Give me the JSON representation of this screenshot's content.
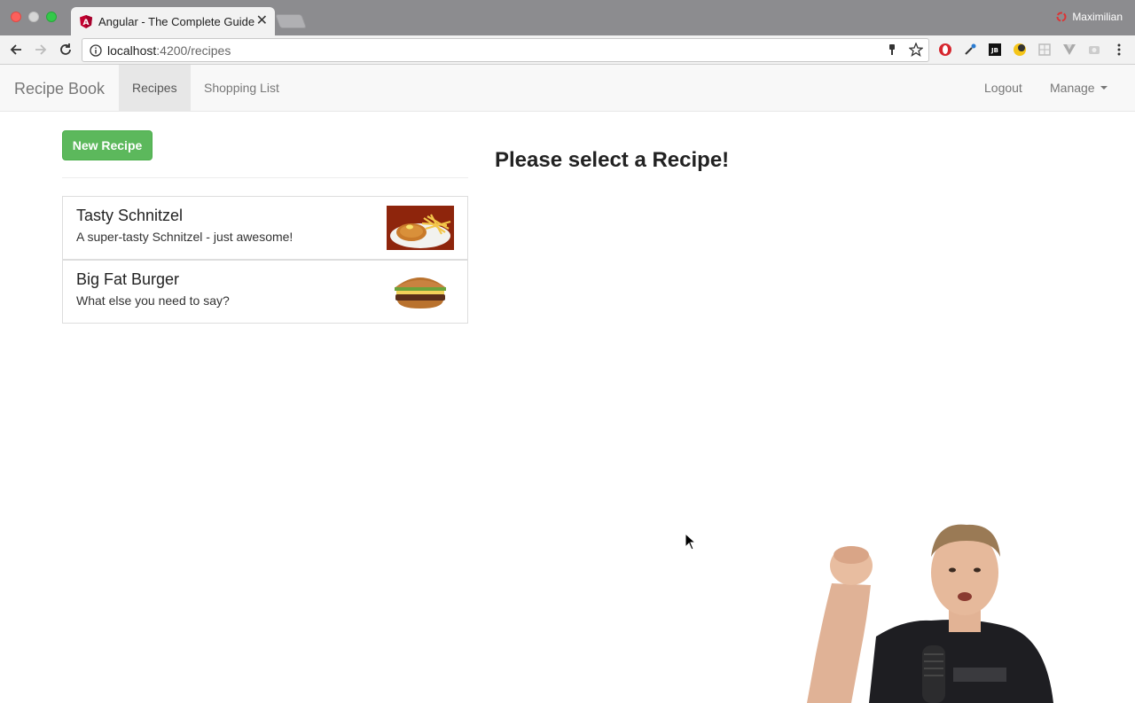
{
  "browser": {
    "tab_title": "Angular - The Complete Guide",
    "profile_name": "Maximilian",
    "url_host": "localhost",
    "url_path": ":4200/recipes"
  },
  "navbar": {
    "brand": "Recipe Book",
    "items": [
      {
        "label": "Recipes",
        "active": true
      },
      {
        "label": "Shopping List",
        "active": false
      }
    ],
    "right_items": [
      {
        "label": "Logout"
      },
      {
        "label": "Manage"
      }
    ]
  },
  "main": {
    "new_recipe_label": "New Recipe",
    "select_message": "Please select a Recipe!",
    "recipes": [
      {
        "name": "Tasty Schnitzel",
        "description": "A super-tasty Schnitzel - just awesome!"
      },
      {
        "name": "Big Fat Burger",
        "description": "What else you need to say?"
      }
    ]
  },
  "colors": {
    "success": "#5cb85c",
    "navbar_bg": "#f8f8f8",
    "active_nav": "#e7e7e7"
  }
}
